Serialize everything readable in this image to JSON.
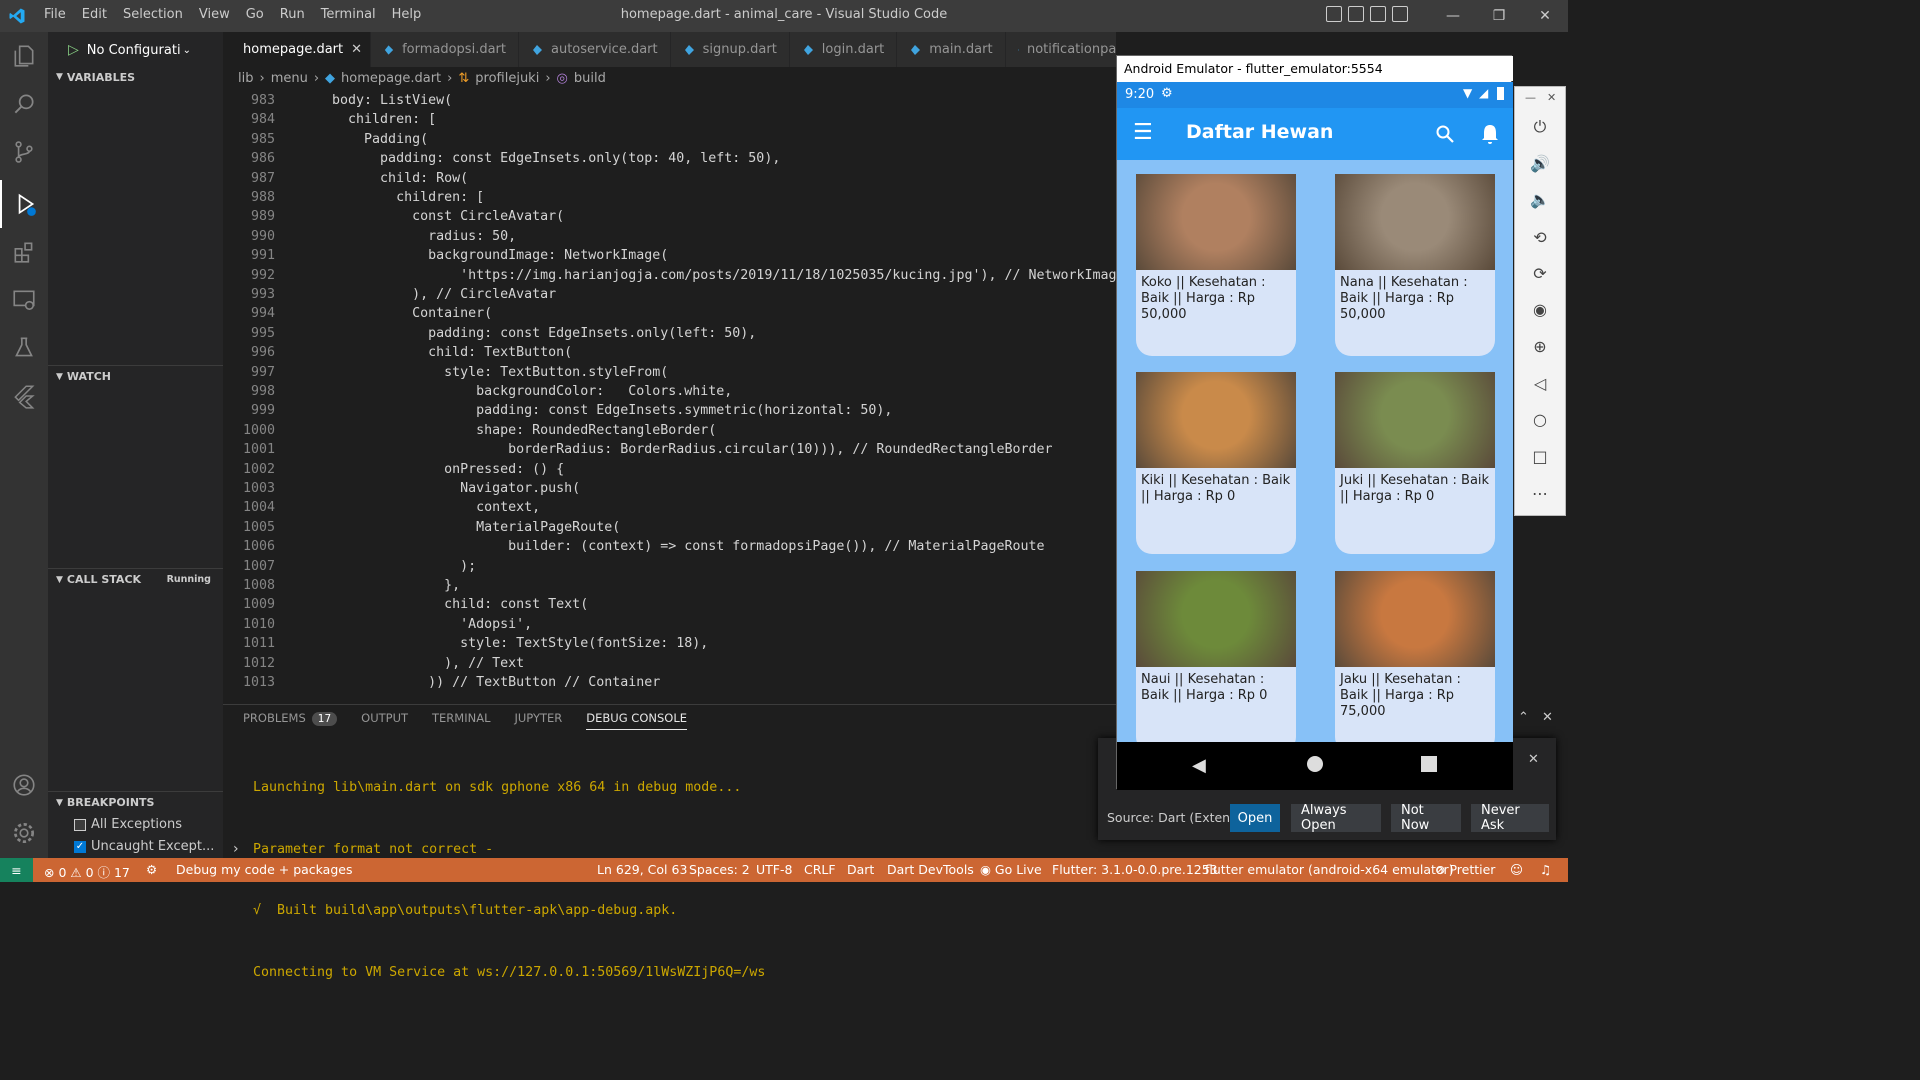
{
  "titlebar": {
    "menu": [
      "File",
      "Edit",
      "Selection",
      "View",
      "Go",
      "Run",
      "Terminal",
      "Help"
    ],
    "title": "homepage.dart - animal_care - Visual Studio Code"
  },
  "sidebar": {
    "run_config": "No Configurati",
    "variables": "VARIABLES",
    "watch": "WATCH",
    "call_stack": "CALL STACK",
    "call_stack_status": "Running",
    "breakpoints": "BREAKPOINTS",
    "bp_all": "All Exceptions",
    "bp_uncaught": "Uncaught Except..."
  },
  "tabs": [
    "homepage.dart",
    "formadopsi.dart",
    "autoservice.dart",
    "signup.dart",
    "login.dart",
    "main.dart",
    "notificationpage"
  ],
  "breadcrumb": [
    "lib",
    "menu",
    "homepage.dart",
    "profilejuki",
    "build"
  ],
  "editor": {
    "lines": [
      {
        "n": "983",
        "code": "    body: ListView("
      },
      {
        "n": "984",
        "code": "      children: ["
      },
      {
        "n": "985",
        "code": "        Padding("
      },
      {
        "n": "986",
        "code": "          padding: const EdgeInsets.only(top: 40, left: 50),"
      },
      {
        "n": "987",
        "code": "          child: Row("
      },
      {
        "n": "988",
        "code": "            children: ["
      },
      {
        "n": "989",
        "code": "              const CircleAvatar("
      },
      {
        "n": "990",
        "code": "                radius: 50,"
      },
      {
        "n": "991",
        "code": "                backgroundImage: NetworkImage("
      },
      {
        "n": "992",
        "code": "                    'https://img.harianjogja.com/posts/2019/11/18/1025035/kucing.jpg'), // NetworkImag"
      },
      {
        "n": "993",
        "code": "              ), // CircleAvatar"
      },
      {
        "n": "994",
        "code": "              Container("
      },
      {
        "n": "995",
        "code": "                padding: const EdgeInsets.only(left: 50),"
      },
      {
        "n": "996",
        "code": "                child: TextButton("
      },
      {
        "n": "997",
        "code": "                  style: TextButton.styleFrom("
      },
      {
        "n": "998",
        "code": "                      backgroundColor:   Colors.white,"
      },
      {
        "n": "999",
        "code": "                      padding: const EdgeInsets.symmetric(horizontal: 50),"
      },
      {
        "n": "1000",
        "code": "                      shape: RoundedRectangleBorder("
      },
      {
        "n": "1001",
        "code": "                          borderRadius: BorderRadius.circular(10))), // RoundedRectangleBorder"
      },
      {
        "n": "1002",
        "code": "                  onPressed: () {"
      },
      {
        "n": "1003",
        "code": "                    Navigator.push("
      },
      {
        "n": "1004",
        "code": "                      context,"
      },
      {
        "n": "1005",
        "code": "                      MaterialPageRoute("
      },
      {
        "n": "1006",
        "code": "                          builder: (context) => const formadopsiPage()), // MaterialPageRoute"
      },
      {
        "n": "1007",
        "code": "                    );"
      },
      {
        "n": "1008",
        "code": "                  },"
      },
      {
        "n": "1009",
        "code": "                  child: const Text("
      },
      {
        "n": "1010",
        "code": "                    'Adopsi',"
      },
      {
        "n": "1011",
        "code": "                    style: TextStyle(fontSize: 18),"
      },
      {
        "n": "1012",
        "code": "                  ), // Text"
      },
      {
        "n": "1013",
        "code": "                )) // TextButton // Container"
      }
    ]
  },
  "panel": {
    "tabs": [
      "PROBLEMS",
      "OUTPUT",
      "TERMINAL",
      "JUPYTER",
      "DEBUG CONSOLE"
    ],
    "problems_count": "17",
    "console": [
      "Launching lib\\main.dart on sdk gphone x86 64 in debug mode...",
      "Parameter format not correct -",
      "√  Built build\\app\\outputs\\flutter-apk\\app-debug.apk.",
      "Connecting to VM Service at ws://127.0.0.1:50569/1lWsWZIjP6Q=/ws"
    ]
  },
  "notification": {
    "source": "Source: Dart (Extens...",
    "open": "Open",
    "always_open": "Always Open",
    "not_now": "Not Now",
    "never_ask": "Never Ask"
  },
  "statusbar": {
    "errors": "0",
    "warnings": "0",
    "infos": "17",
    "debug": "Debug my code + packages",
    "position": "Ln 629, Col 63",
    "spaces": "Spaces: 2",
    "encoding": "UTF-8",
    "eol": "CRLF",
    "lang": "Dart",
    "devtools": "Dart DevTools",
    "golive": "Go Live",
    "flutter": "Flutter: 3.1.0-0.0.pre.1253",
    "device": "flutter emulator (android-x64 emulator)",
    "prettier": "Prettier"
  },
  "emulator": {
    "title": "Android Emulator - flutter_emulator:5554",
    "time": "9:20",
    "app_title": "Daftar Hewan",
    "cards": [
      {
        "text": "Koko || Kesehatan : Baik || Harga : Rp 50,000",
        "color": "#b08060"
      },
      {
        "text": "Nana || Kesehatan : Baik || Harga : Rp 50,000",
        "color": "#9a8a78"
      },
      {
        "text": "Kiki || Kesehatan : Baik || Harga : Rp 0",
        "color": "#c98a4a"
      },
      {
        "text": "Juki || Kesehatan : Baik || Harga : Rp 0",
        "color": "#7a8c50"
      },
      {
        "text": "Naui || Kesehatan : Baik || Harga : Rp 0",
        "color": "#6d8a3a"
      },
      {
        "text": "Jaku || Kesehatan : Baik || Harga : Rp 75,000",
        "color": "#c87840"
      }
    ]
  },
  "colors": {
    "statusbar": "#cc6633",
    "appbar": "#2196f3",
    "phone_bg": "#87c1f7"
  }
}
